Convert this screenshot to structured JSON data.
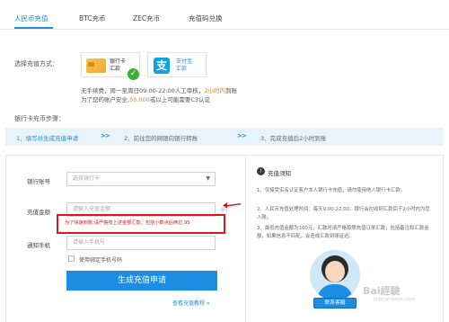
{
  "tabs": {
    "items": [
      "人民币充值",
      "BTC充币",
      "ZEC充币",
      "充值码兑换"
    ],
    "active": "人民币充值"
  },
  "method": {
    "label": "选择充值方式：",
    "bank": {
      "line1": "银行卡",
      "line2": "汇款"
    },
    "alipay": {
      "line1": "支付宝",
      "line2": "汇款"
    }
  },
  "notice": {
    "line1_prefix": "无手续费，周一至周日09:00-22:00人工审核，",
    "line1_highlight": "2小时内",
    "line1_suffix": "到账",
    "line2_prefix": "为了您的账户安全,",
    "line2_highlight": "50,000",
    "line2_suffix": "或以上可能需要C3认证"
  },
  "steps": {
    "label": "银行卡充币步骤：",
    "items": [
      "1、填写并生成充值申请",
      "2、前往您的网银向银行转账",
      "3、完成充值后2小时到账"
    ],
    "arrow": ">>"
  },
  "form": {
    "bank_account_label": "银行账号",
    "bank_account_placeholder": "选择银行卡",
    "amount_label": "充值金额",
    "amount_placeholder": "请输入充值金额",
    "amount_suffix": ".95",
    "warning": "为了快速到账,请严格按上述金额汇款，包括小数点后两位.95",
    "phone_label": "通知手机",
    "phone_placeholder": "请输入手机号",
    "bind_phone_label": "使用绑定手机号码",
    "submit_label": "生成充值申请",
    "tutorial_link": "查看充值教程 »"
  },
  "info": {
    "title": "充值须知",
    "items": [
      "1、仅接受实名认证客户本人银行卡充值，请勿使用他人银行卡汇款。",
      "2、人民币充值处理时间：每天9:00-22:00，银行会在收到汇款后于2小时内为您入账。",
      "3、最低充值金额为100元，汇款时请严格按照充值订单汇款，包括备注和汇款金额，如果信息不匹配，会造成汇款到账延迟。"
    ]
  },
  "contact": {
    "label": "联系客服"
  },
  "watermark": {
    "text": "Bai經驗",
    "sub": "jingyan.baidu.com"
  },
  "colors": {
    "accent": "#1a8fe0",
    "warning": "#e0151b",
    "highlight": "#f47b20",
    "success": "#3cb034"
  }
}
